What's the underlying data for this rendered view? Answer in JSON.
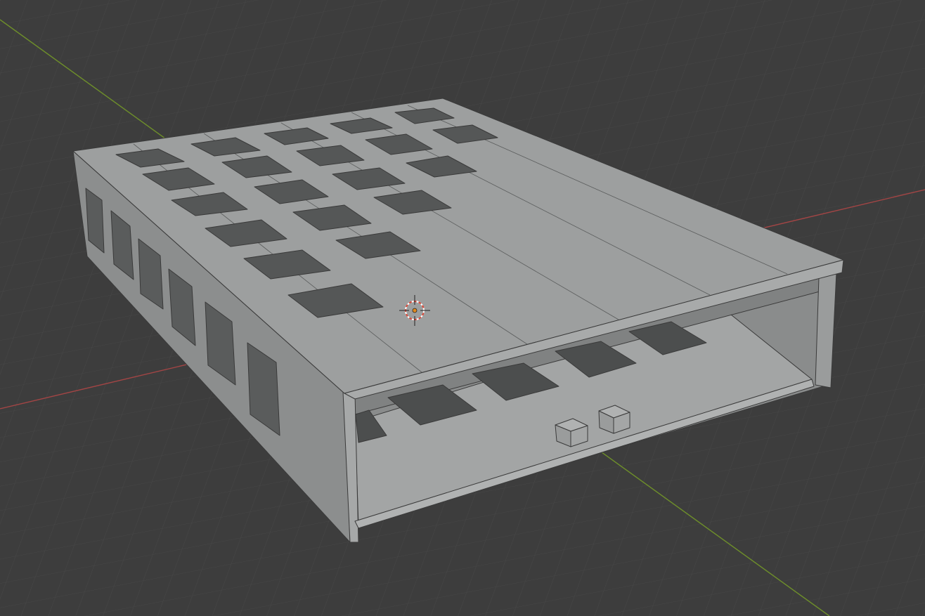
{
  "viewport": {
    "background": "#3d3d3d",
    "grid_line_color": "#4a4a4a",
    "x_axis_color": "#b84a4a",
    "y_axis_color": "#7a9a2e"
  },
  "model": {
    "name": "enclosure-box",
    "top_color": "#9c9e9e",
    "side_color": "#8f9191",
    "front_color": "#a4a6a6",
    "hole_color": "#4a4a4a",
    "edge_color": "#3a3a3a"
  },
  "scene_objects": {
    "cursor_icon": "3d-cursor-icon",
    "origin_icon": "object-origin-icon"
  }
}
